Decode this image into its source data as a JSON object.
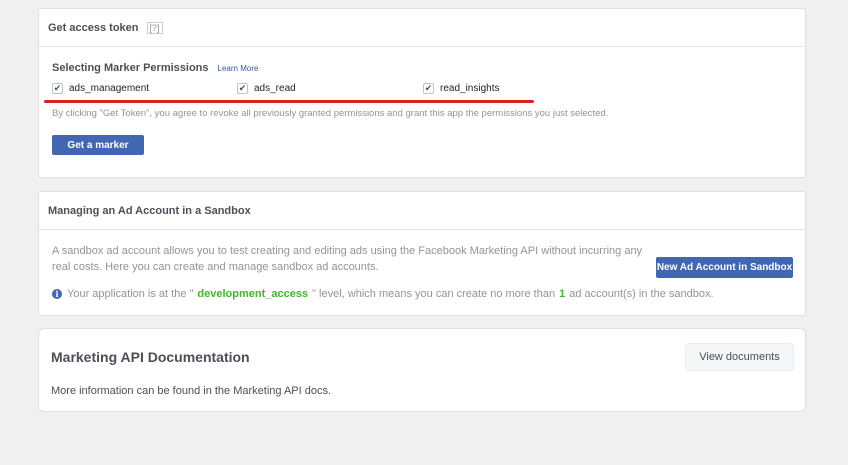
{
  "token_panel": {
    "title": "Get access token",
    "help": "[?]",
    "section_title": "Selecting Marker Permissions",
    "learn_more": "Learn More",
    "permissions": [
      {
        "label": "ads_management",
        "checked": true
      },
      {
        "label": "ads_read",
        "checked": true
      },
      {
        "label": "read_insights",
        "checked": true
      }
    ],
    "note": "By clicking \"Get Token\", you agree to revoke all previously granted permissions and grant this app the permissions you just selected.",
    "button": "Get a marker"
  },
  "sandbox_panel": {
    "title": "Managing an Ad Account in a Sandbox",
    "description": "A sandbox ad account allows you to test creating and editing ads using the Facebook Marketing API without incurring any real costs. Here you can create and manage sandbox ad accounts.",
    "button": "New Ad Account in Sandbox",
    "level_prefix": "Your application is at the \"",
    "level_value": "development_access",
    "level_middle": "\" level, which means you can create no more than",
    "level_count": "1",
    "level_suffix": "ad account(s) in the sandbox."
  },
  "docs_panel": {
    "title": "Marketing API Documentation",
    "button": "View documents",
    "text": "More information can be found in the Marketing API docs."
  },
  "colors": {
    "accent": "#4267b2",
    "highlight_line": "#e02020",
    "status_green": "#42b72a"
  }
}
